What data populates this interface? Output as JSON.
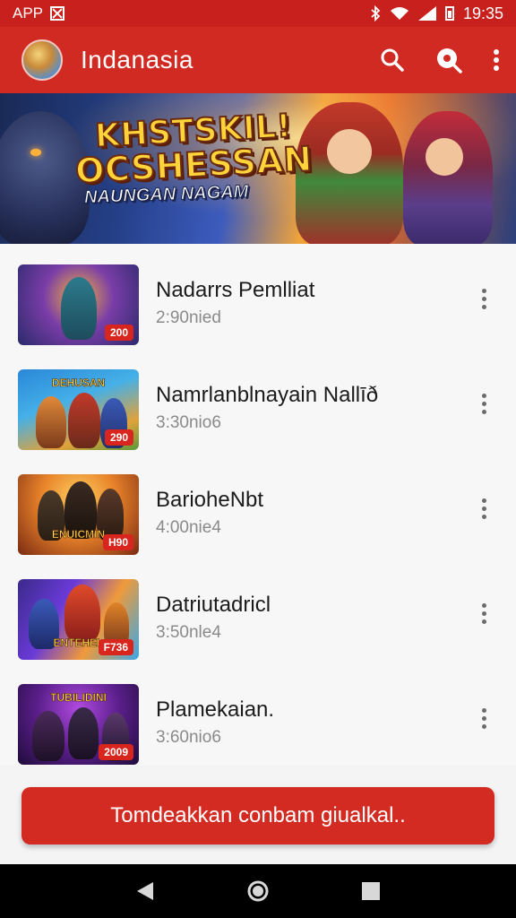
{
  "status_bar": {
    "left_text": "APP",
    "time": "19:35"
  },
  "app_bar": {
    "title": "Indanasia",
    "icons": [
      "search-icon",
      "explore-icon",
      "more-vert-icon"
    ]
  },
  "banner": {
    "title_line1": "KHSTSKIL!",
    "title_line2": "OCSHESSAN",
    "subtitle": "NAUNGAN NAGAM"
  },
  "items": [
    {
      "title": "Nadarrs Pemlliat",
      "meta": "2:90nied",
      "badge": "200"
    },
    {
      "title": "Namrlanblnayain Nallīð",
      "meta": "3:30nio6",
      "badge": "290",
      "thumb_label": "DEHUSAN"
    },
    {
      "title": "BarioheNbt",
      "meta": "4:00nie4",
      "badge": "H90",
      "thumb_label": "ENUICMIN"
    },
    {
      "title": "Datriutadricl",
      "meta": "3:50nle4",
      "badge": "F736",
      "thumb_label": "ENTEHEL"
    },
    {
      "title": "Plamekaian.",
      "meta": "3:60nio6",
      "badge": "2009",
      "thumb_label": "TUBILIDINI"
    }
  ],
  "action_button": {
    "label": "Tomdeakkan conbam giualkal.."
  },
  "colors": {
    "primary": "#d02a22",
    "status_bar": "#c8201c",
    "nav_bar": "#000000"
  },
  "nav_icons": [
    "back-icon",
    "home-icon",
    "recents-icon"
  ]
}
